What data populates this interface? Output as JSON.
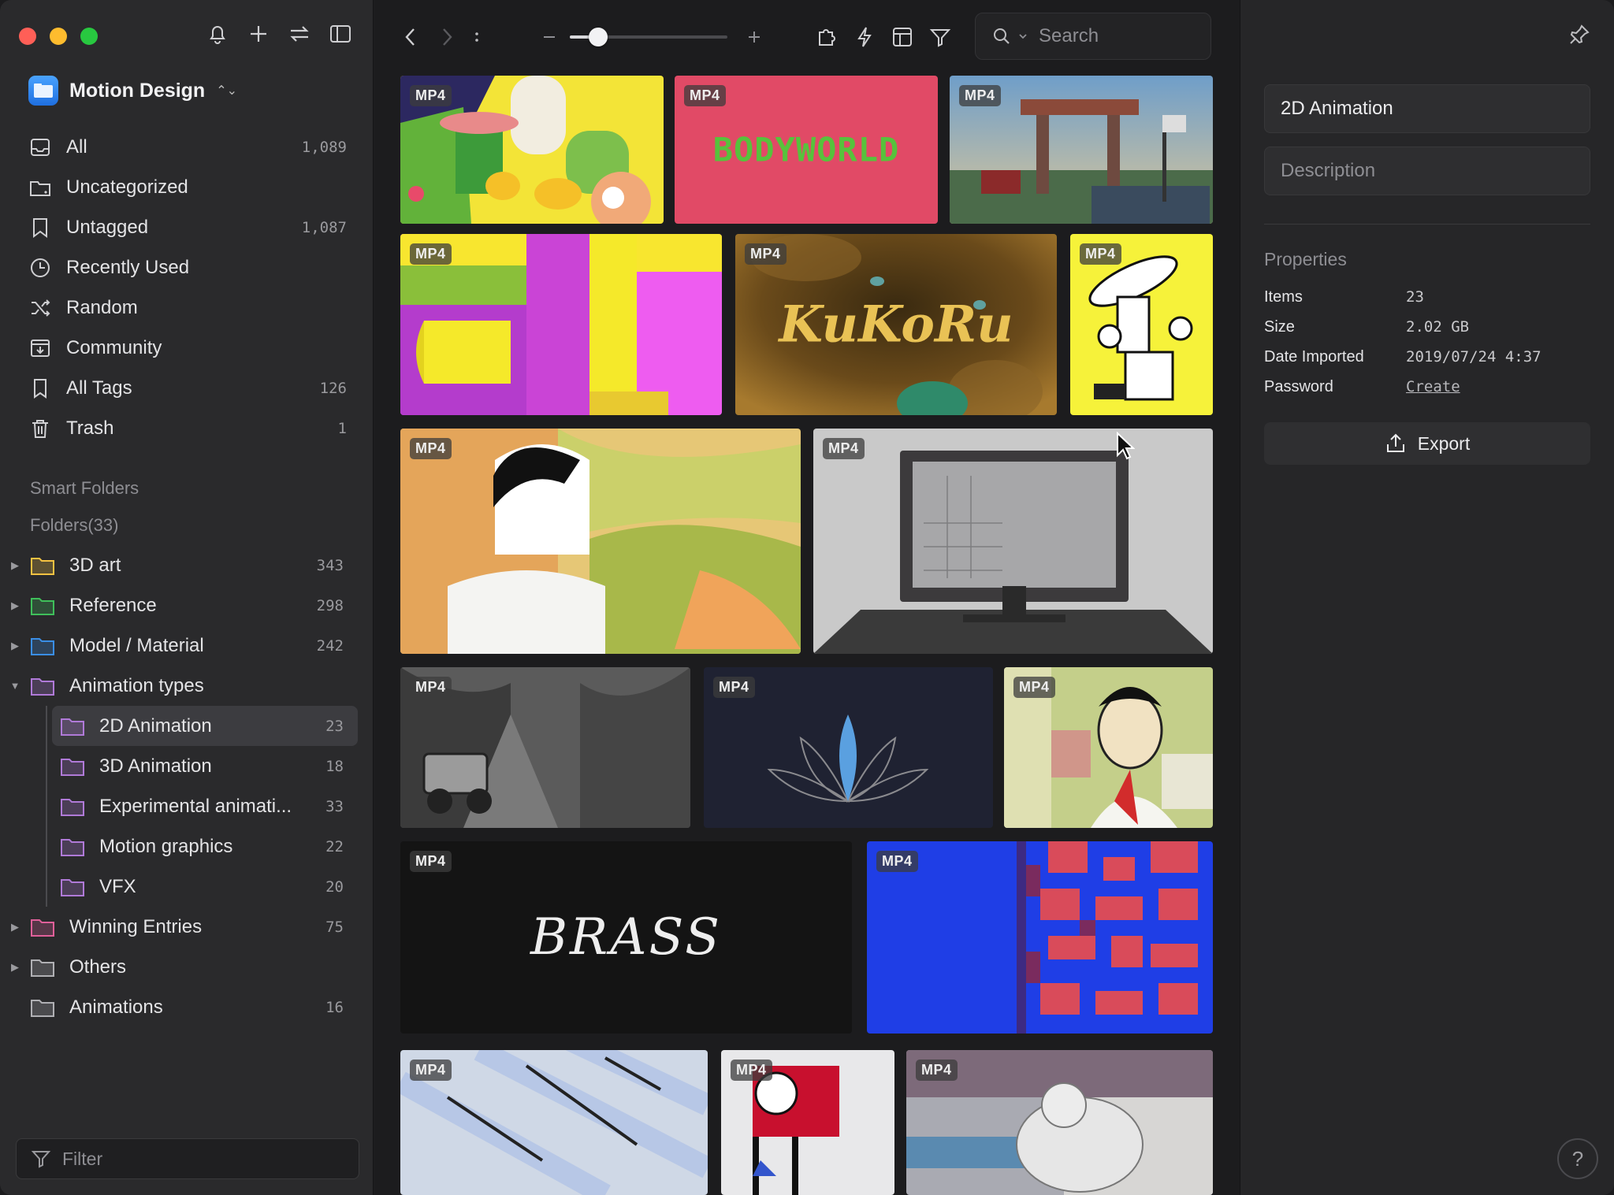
{
  "library": {
    "name": "Motion Design"
  },
  "search": {
    "placeholder": "Search"
  },
  "filter": {
    "placeholder": "Filter"
  },
  "nav": [
    {
      "label": "All",
      "count": "1,089",
      "icon": "inbox-icon"
    },
    {
      "label": "Uncategorized",
      "count": "",
      "icon": "folder-question-icon"
    },
    {
      "label": "Untagged",
      "count": "1,087",
      "icon": "tag-question-icon"
    },
    {
      "label": "Recently Used",
      "count": "",
      "icon": "clock-icon"
    },
    {
      "label": "Random",
      "count": "",
      "icon": "shuffle-icon"
    },
    {
      "label": "Community",
      "count": "",
      "icon": "download-tray-icon"
    },
    {
      "label": "All Tags",
      "count": "126",
      "icon": "bookmark-icon"
    },
    {
      "label": "Trash",
      "count": "1",
      "icon": "trash-icon"
    }
  ],
  "sections": {
    "smart_folders": "Smart Folders",
    "folders": "Folders(33)"
  },
  "folders": [
    {
      "label": "3D art",
      "count": "343",
      "color": "#f5c242",
      "expand": "collapsed",
      "level": 0
    },
    {
      "label": "Reference",
      "count": "298",
      "color": "#3fbf5a",
      "expand": "collapsed",
      "level": 0
    },
    {
      "label": "Model / Material",
      "count": "242",
      "color": "#3a8ee6",
      "expand": "collapsed",
      "level": 0
    },
    {
      "label": "Animation types",
      "count": "",
      "color": "#b07ad8",
      "expand": "expanded",
      "level": 0
    },
    {
      "label": "2D Animation",
      "count": "23",
      "color": "#b07ad8",
      "expand": "none",
      "level": 1,
      "selected": true
    },
    {
      "label": "3D Animation",
      "count": "18",
      "color": "#b07ad8",
      "expand": "none",
      "level": 1
    },
    {
      "label": "Experimental animati...",
      "count": "33",
      "color": "#b07ad8",
      "expand": "none",
      "level": 1
    },
    {
      "label": "Motion graphics",
      "count": "22",
      "color": "#b07ad8",
      "expand": "none",
      "level": 1
    },
    {
      "label": "VFX",
      "count": "20",
      "color": "#b07ad8",
      "expand": "none",
      "level": 1
    },
    {
      "label": "Winning Entries",
      "count": "75",
      "color": "#e0609a",
      "expand": "collapsed",
      "level": 0
    },
    {
      "label": "Others",
      "count": "",
      "color": "#b0b0b4",
      "expand": "collapsed",
      "level": 0
    },
    {
      "label": "Animations",
      "count": "16",
      "color": "#b0b0b4",
      "expand": "none",
      "level": 0
    }
  ],
  "toolbar": {
    "zoom_fraction": 0.18
  },
  "thumbs": [
    {
      "badge": "MP4",
      "text": ""
    },
    {
      "badge": "MP4",
      "text": "BODYWORLD"
    },
    {
      "badge": "MP4",
      "text": ""
    },
    {
      "badge": "MP4",
      "text": ""
    },
    {
      "badge": "MP4",
      "text": "KuKoRu"
    },
    {
      "badge": "MP4",
      "text": ""
    },
    {
      "badge": "MP4",
      "text": ""
    },
    {
      "badge": "MP4",
      "text": ""
    },
    {
      "badge": "MP4",
      "text": ""
    },
    {
      "badge": "MP4",
      "text": ""
    },
    {
      "badge": "MP4",
      "text": ""
    },
    {
      "badge": "MP4",
      "text": "BRASS"
    },
    {
      "badge": "MP4",
      "text": ""
    },
    {
      "badge": "MP4",
      "text": ""
    },
    {
      "badge": "MP4",
      "text": ""
    },
    {
      "badge": "MP4",
      "text": ""
    }
  ],
  "inspector": {
    "title": "2D Animation",
    "description_placeholder": "Description",
    "properties_title": "Properties",
    "props": [
      {
        "key": "Items",
        "value": "23"
      },
      {
        "key": "Size",
        "value": "2.02 GB"
      },
      {
        "key": "Date Imported",
        "value": "2019/07/24 4:37"
      },
      {
        "key": "Password",
        "value": "Create"
      }
    ],
    "export_label": "Export",
    "help_label": "?"
  }
}
